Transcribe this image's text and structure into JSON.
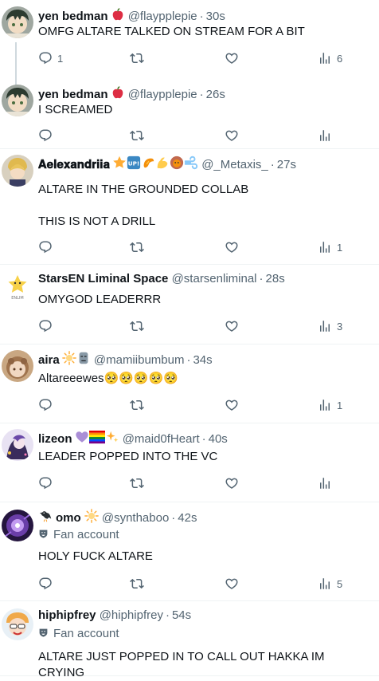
{
  "tweets": [
    {
      "name": "yen bedman",
      "emojis": [
        "apple"
      ],
      "handle": "@flaypplepie",
      "time": "30s",
      "text": "OMFG ALTARE TALKED ON STREAM FOR A BIT",
      "replies": "1",
      "retweets": "",
      "likes": "",
      "views": "6",
      "avatar": "yen-avatar",
      "threaded": true
    },
    {
      "name": "yen bedman",
      "emojis": [
        "apple"
      ],
      "handle": "@flaypplepie",
      "time": "26s",
      "text": "I SCREAMED",
      "replies": "",
      "retweets": "",
      "likes": "",
      "views": "",
      "avatar": "yen-avatar"
    },
    {
      "name": "𝐀𝐞𝐥𝐞𝐱𝐚𝐧𝐝𝐫𝐢𝐢𝐚",
      "emojis": [
        "star",
        "up-button",
        "shrimp",
        "flexed-biceps",
        "lion",
        "wind"
      ],
      "handle": "@_Metaxis_",
      "time": "27s",
      "text": "ALTARE IN THE GROUNDED COLLAB\n\nTHIS IS NOT A DRILL",
      "replies": "",
      "retweets": "",
      "likes": "",
      "views": "1",
      "avatar": "aelex-avatar"
    },
    {
      "name": "StarsEN Liminal Space",
      "emojis": [],
      "handle": "@starsenliminal",
      "time": "28s",
      "text": "OMYGOD LEADERRR",
      "replies": "",
      "retweets": "",
      "likes": "",
      "views": "3",
      "avatar": "starsen-avatar"
    },
    {
      "name": "aira",
      "emojis": [
        "sun",
        "moai"
      ],
      "handle": "@mamiibumbum",
      "time": "34s",
      "text": "Altareeewes🥺🥺🥺🥺🥺",
      "replies": "",
      "retweets": "",
      "likes": "",
      "views": "1",
      "avatar": "aira-avatar"
    },
    {
      "name": "lizeon",
      "emojis": [
        "purple-heart",
        "rainbow-flag",
        "sparkles"
      ],
      "handle": "@maid0fHeart",
      "time": "40s",
      "text": "LEADER POPPED INTO THE VC",
      "replies": "",
      "retweets": "",
      "likes": "",
      "views": "",
      "avatar": "lizeon-avatar"
    },
    {
      "name": "omo",
      "emojis": [
        "crow",
        "sun"
      ],
      "name_after_emoji": true,
      "handle": "@synthaboo",
      "time": "42s",
      "fan": "Fan account",
      "text": "HOLY FUCK ALTARE",
      "replies": "",
      "retweets": "",
      "likes": "",
      "views": "5",
      "avatar": "omo-avatar"
    },
    {
      "name": "hiphipfrey",
      "emojis": [],
      "handle": "@hiphipfrey",
      "time": "54s",
      "fan": "Fan account",
      "text": "ALTARE JUST POPPED IN TO CALL OUT HAKKA IM CRYING",
      "avatar": "hiphip-avatar"
    }
  ],
  "dot": "·"
}
